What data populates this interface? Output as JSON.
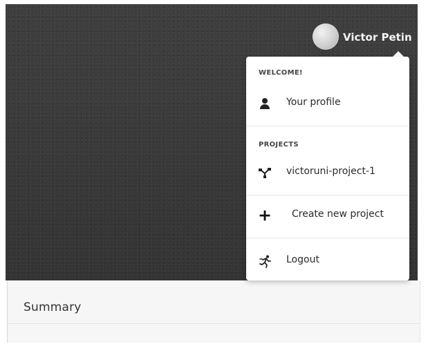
{
  "header": {
    "user_name": "Victor Petin"
  },
  "menu": {
    "welcome_label": "WELCOME!",
    "profile_label": "Your profile",
    "projects_label": "PROJECTS",
    "project_item_label": "victoruni-project-1",
    "create_label": "Create new project",
    "logout_label": "Logout",
    "icons": {
      "profile": "user-icon",
      "project": "project-graph-icon",
      "create": "plus-icon",
      "logout": "runner-icon"
    }
  },
  "content": {
    "title": "Summary"
  }
}
